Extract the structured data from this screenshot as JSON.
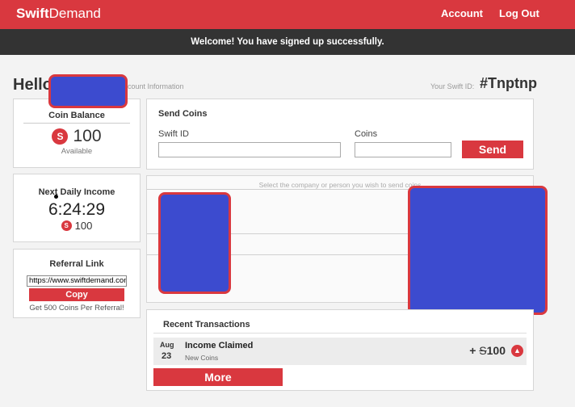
{
  "brand": {
    "logo_bold": "Swift",
    "logo_light": "Demand",
    "accent": "#d9383f"
  },
  "nav": {
    "account": "Account",
    "logout": "Log Out"
  },
  "banner": {
    "message": "Welcome! You have signed up successfully."
  },
  "header": {
    "hello": "Hello",
    "account_info": "count Information",
    "swift_id_label": "Your Swift ID:",
    "swift_id_value": "#Tnptnp"
  },
  "coin_balance": {
    "title": "Coin Balance",
    "icon": "swift-coin-icon",
    "amount": "100",
    "sub": "Available"
  },
  "daily_income": {
    "title": "Next Daily Income",
    "timer": "6:24:29",
    "amount": "100"
  },
  "referral": {
    "title": "Referral Link",
    "link_value": "https://www.swiftdemand.com",
    "copy_label": "Copy",
    "note": "Get 500 Coins Per Referral!"
  },
  "send_coins": {
    "title": "Send Coins",
    "swift_id_label": "Swift ID",
    "coins_label": "Coins",
    "send_label": "Send",
    "hint": "Select the company or person you wish to send coins"
  },
  "transactions": {
    "title": "Recent Transactions",
    "rows": [
      {
        "month": "Aug",
        "day": "23",
        "name": "Income Claimed",
        "sub": "New Coins",
        "amount_prefix": "+",
        "amount_symbol": "S",
        "amount": "100",
        "icon": "chevron-up-icon"
      }
    ],
    "more_label": "More"
  }
}
